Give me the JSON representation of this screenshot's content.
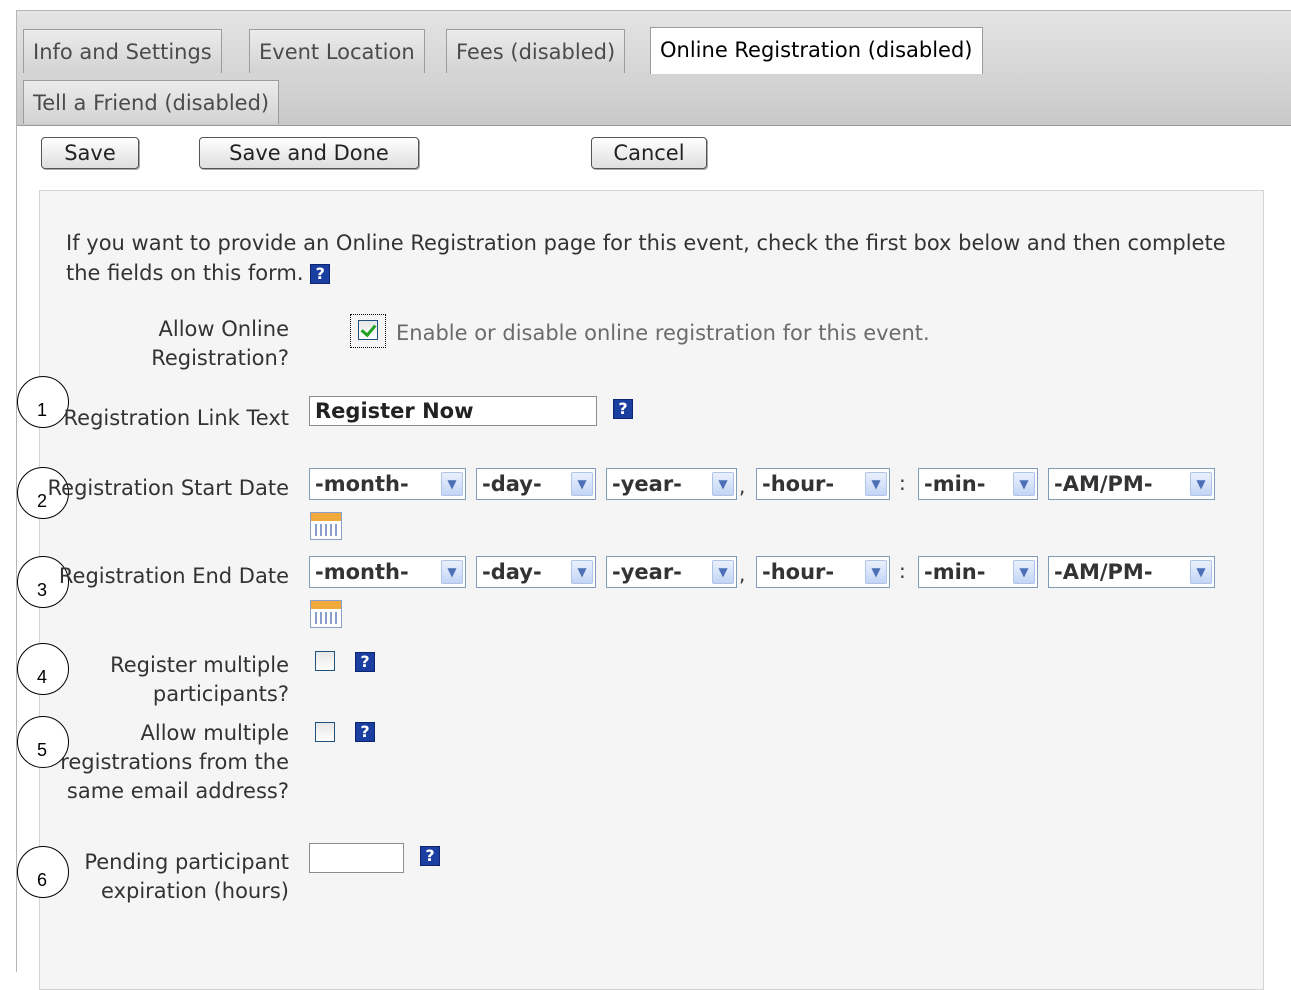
{
  "tabs": [
    {
      "label": "Info and Settings",
      "active": false
    },
    {
      "label": "Event Location",
      "active": false
    },
    {
      "label": "Fees (disabled)",
      "active": false
    },
    {
      "label": "Online Registration (disabled)",
      "active": true
    },
    {
      "label": "Tell a Friend (disabled)",
      "active": false
    }
  ],
  "toolbar": {
    "save_label": "Save",
    "save_done_label": "Save and Done",
    "cancel_label": "Cancel"
  },
  "intro_text": "If you want to provide an Online Registration page for this event, check the first box below and then complete the fields on this form.",
  "help_glyph": "?",
  "form": {
    "allow_online": {
      "label": "Allow Online Registration?",
      "checked": true,
      "description": "Enable or disable online registration for this event."
    },
    "link_text": {
      "label": "Registration Link Text",
      "value": "Register Now",
      "marker": "1"
    },
    "start_date": {
      "label": "Registration Start Date",
      "marker": "2",
      "month": "-month-",
      "day": "-day-",
      "year": "-year-",
      "hour": "-hour-",
      "min": "-min-",
      "ampm": "-AM/PM-"
    },
    "end_date": {
      "label": "Registration End Date",
      "marker": "3",
      "month": "-month-",
      "day": "-day-",
      "year": "-year-",
      "hour": "-hour-",
      "min": "-min-",
      "ampm": "-AM/PM-"
    },
    "multiple_participants": {
      "label": "Register multiple participants?",
      "marker": "4",
      "checked": false
    },
    "multiple_registrations": {
      "label": "Allow multiple registrations from the same email address?",
      "marker": "5",
      "checked": false
    },
    "pending_expiration": {
      "label": "Pending participant expiration (hours)",
      "marker": "6",
      "value": ""
    }
  },
  "separators": {
    "comma": ",",
    "colon": ":"
  },
  "icons": {
    "help": "help-icon",
    "calendar": "calendar-icon",
    "dropdown": "chevron-down-icon"
  },
  "colors": {
    "help_bg": "#1a3fa0",
    "check": "#21a121",
    "tabbar": "#d4d4d4"
  }
}
